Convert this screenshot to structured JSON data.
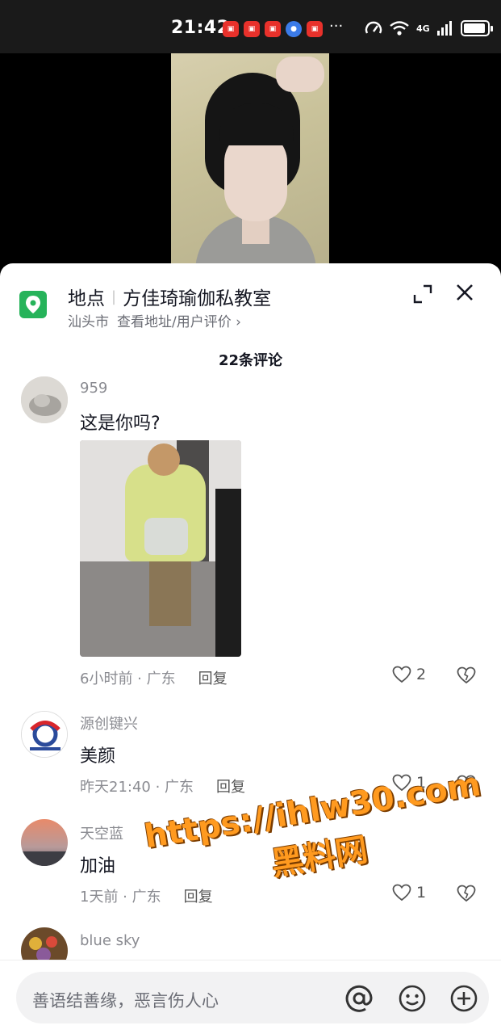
{
  "status_bar": {
    "time": "21:42",
    "dots": "···",
    "network": "4G"
  },
  "location": {
    "label": "地点",
    "name": "方佳琦瑜伽私教室",
    "city": "汕头市",
    "link": "查看地址/用户评价 ›"
  },
  "comment_count": "22条评论",
  "comments": [
    {
      "user": "959",
      "text": "这是你吗?",
      "time": "6小时前 · 广东",
      "reply": "回复",
      "likes": "2",
      "has_image": true
    },
    {
      "user": "源创键兴",
      "text": "美颜",
      "time": "昨天21:40 · 广东",
      "reply": "回复",
      "likes": "1"
    },
    {
      "user": "天空蓝",
      "text": "加油",
      "time": "1天前 · 广东",
      "reply": "回复",
      "likes": "1"
    },
    {
      "user": "blue sky"
    }
  ],
  "watermark": {
    "url": "https://ihlw30.com",
    "name": "黑料网"
  },
  "input": {
    "placeholder": "善语结善缘，恶言伤人心"
  },
  "colors": {
    "location_green": "#26b35a",
    "watermark_orange": "#ff9a1f"
  }
}
